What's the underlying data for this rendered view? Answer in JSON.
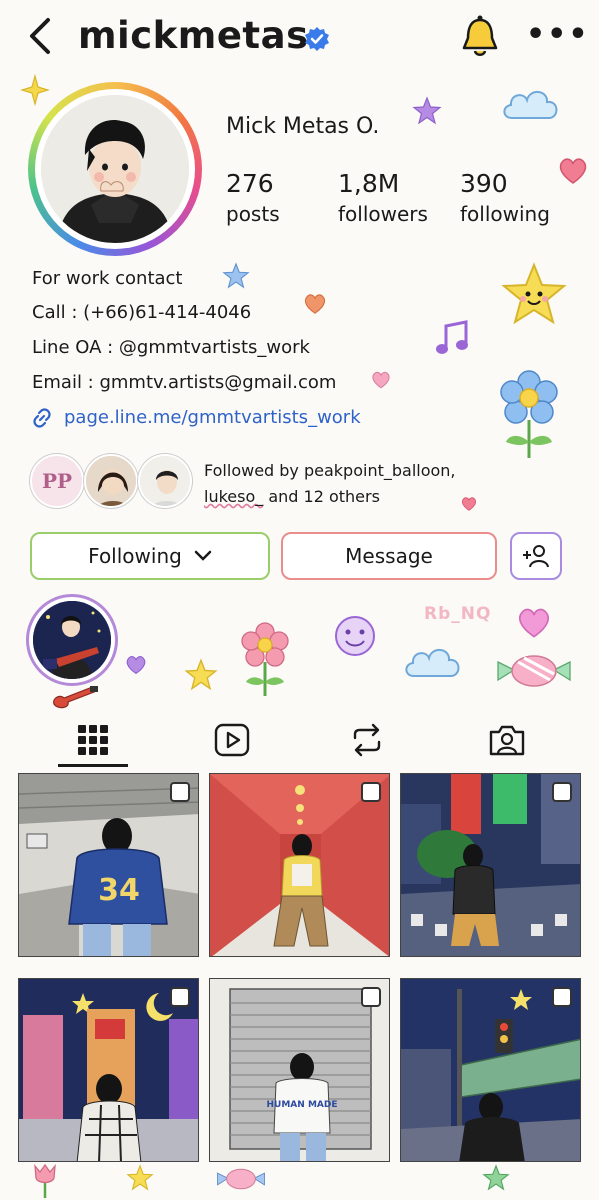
{
  "header": {
    "username": "mickmetas",
    "icons": [
      "back-chevron-icon",
      "verified-badge-icon",
      "bell-icon",
      "more-icon"
    ],
    "more_label": "•••"
  },
  "profile": {
    "full_name": "Mick Metas O.",
    "stats": [
      {
        "value": "276",
        "label": "posts"
      },
      {
        "value": "1,8M",
        "label": "followers"
      },
      {
        "value": "390",
        "label": "following"
      }
    ],
    "bio": [
      "For work contact",
      "Call : (+66)61-414-4046",
      "Line OA : @gmmtvartists_work",
      "Email : gmmtv.artists@gmail.com"
    ],
    "link": "page.line.me/gmmtvartists_work"
  },
  "followed_by": {
    "line1": "Followed by peakpoint_balloon,",
    "line2_a": "lukeso_",
    "line2_b": " and 12 others",
    "avatar_badge": "PP"
  },
  "actions": {
    "following_label": "Following",
    "message_label": "Message"
  },
  "watermark": "Rb_NQ",
  "tabs": [
    "grid-icon",
    "reels-icon",
    "reposts-icon",
    "tagged-icon"
  ],
  "posts": {
    "count_visible": 6,
    "jersey_number": "34",
    "shirt_text": "HUMAN MADE"
  },
  "colors": {
    "link": "#2f62c9",
    "following_border": "#9acd6b",
    "message_border": "#e98d8d",
    "add_border": "#a98be0",
    "verified": "#3a7bea"
  }
}
